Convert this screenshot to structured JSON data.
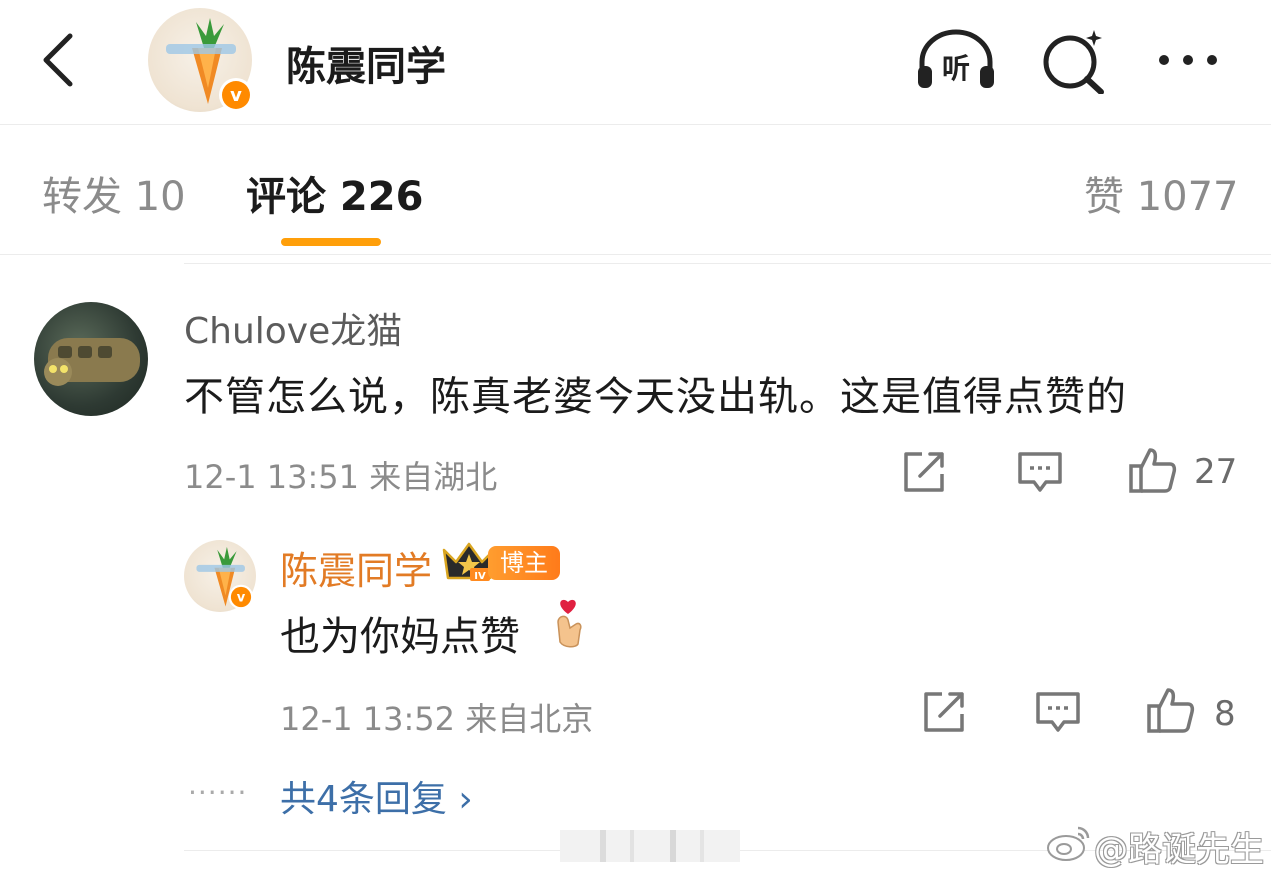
{
  "header": {
    "title": "陈震同学",
    "listen_label": "听",
    "icons": [
      "back-icon",
      "listen-icon",
      "search-icon",
      "more-icon"
    ]
  },
  "tabs": {
    "repost": "转发 10",
    "comment": "评论 226",
    "like": "赞 1077",
    "active": "comment",
    "accent": "#ff9f0a"
  },
  "comment": {
    "username": "Chulove龙猫",
    "text": "不管怎么说，陈真老婆今天没出轨。这是值得点赞的",
    "meta": "12-1 13:51 来自湖北",
    "likes": "27"
  },
  "reply": {
    "username": "陈震同学",
    "badge": "博主",
    "level": "IV",
    "text": "也为你妈点赞",
    "meta": "12-1 13:52 来自北京",
    "likes": "8",
    "name_color": "#e27b25"
  },
  "more_replies": {
    "dots": "······",
    "label": "共4条回复 ›",
    "color": "#3d6fa8"
  },
  "watermark": {
    "text": "@路诞先生"
  }
}
